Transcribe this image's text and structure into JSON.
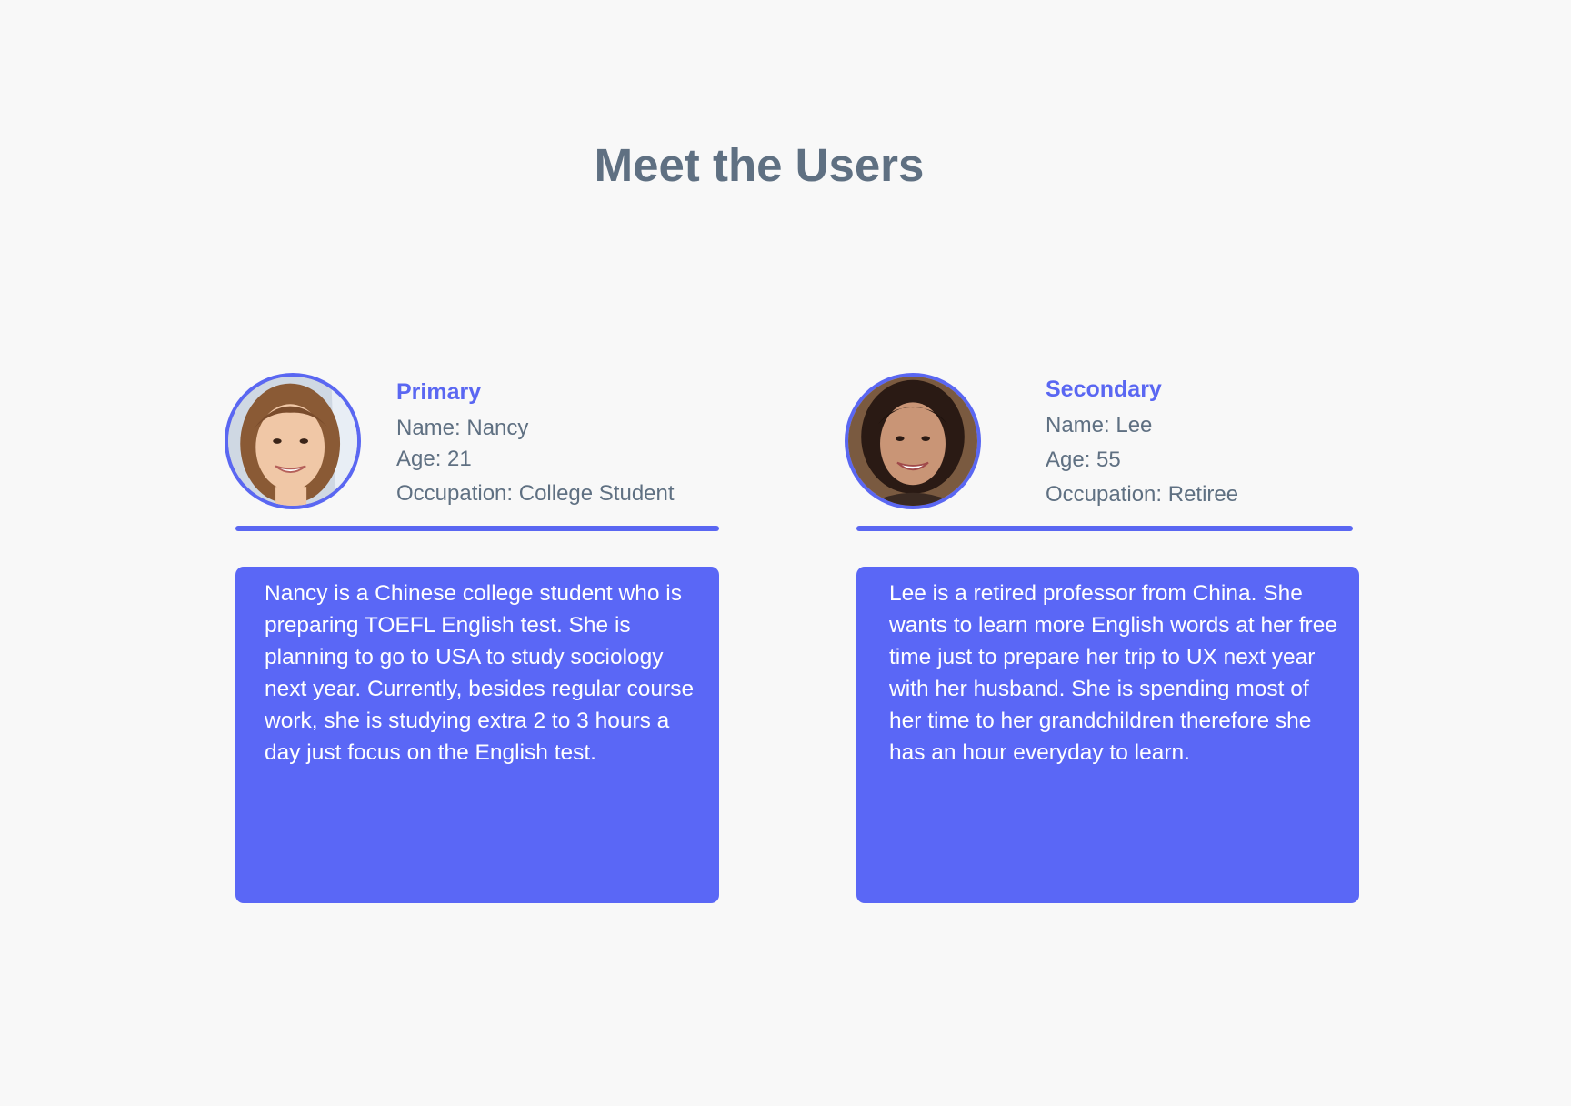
{
  "page": {
    "title": "Meet the Users"
  },
  "colors": {
    "accent": "#5a67f2",
    "card": "#5a67f6",
    "text": "#5f7082",
    "background": "#f8f8f8"
  },
  "personas": [
    {
      "role": "Primary",
      "name": "Name: Nancy",
      "age": "Age: 21",
      "occupation": "Occupation: College Student",
      "bio": "Nancy is a Chinese college student who is preparing TOEFL English test. She is planning to go to USA to study sociology next year. Currently, besides regular course work, she is studying extra 2 to 3 hours a day just focus on the English test.",
      "avatar_icon": "avatar-photo-nancy"
    },
    {
      "role": "Secondary",
      "name": "Name: Lee",
      "age": "Age: 55",
      "occupation": "Occupation: Retiree",
      "bio": "Lee is a retired professor from China. She wants to  learn more English words at her free time just to prepare her trip to UX next year with her husband. She is spending most of her time to her grandchildren therefore she has an hour everyday to learn.",
      "avatar_icon": "avatar-photo-lee"
    }
  ]
}
